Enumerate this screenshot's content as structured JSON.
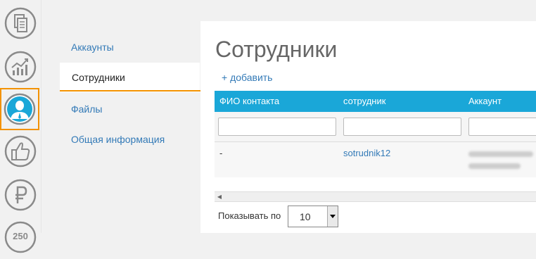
{
  "sidebar": {
    "items": [
      {
        "icon": "documents-icon"
      },
      {
        "icon": "chart-growth-icon"
      },
      {
        "icon": "user-icon",
        "active": true
      },
      {
        "icon": "thumbs-up-icon"
      },
      {
        "icon": "ruble-icon"
      },
      {
        "icon": "badge-250-icon",
        "label": "250"
      }
    ]
  },
  "subnav": {
    "items": [
      {
        "label": "Аккаунты"
      },
      {
        "label": "Сотрудники",
        "active": true
      },
      {
        "label": "Файлы"
      },
      {
        "label": "Общая информация"
      }
    ]
  },
  "main": {
    "title": "Сотрудники",
    "add_label": "+ добавить",
    "table": {
      "columns": [
        "ФИО контакта",
        "сотрудник",
        "Аккаунт"
      ],
      "rows": [
        {
          "fio": "-",
          "employee": "sotrudnik12",
          "account": ""
        }
      ]
    },
    "pager": {
      "label": "Показывать по",
      "page_size": "10"
    }
  },
  "colors": {
    "accent": "#f39200",
    "header": "#1aa7d8",
    "link": "#337ab7"
  }
}
